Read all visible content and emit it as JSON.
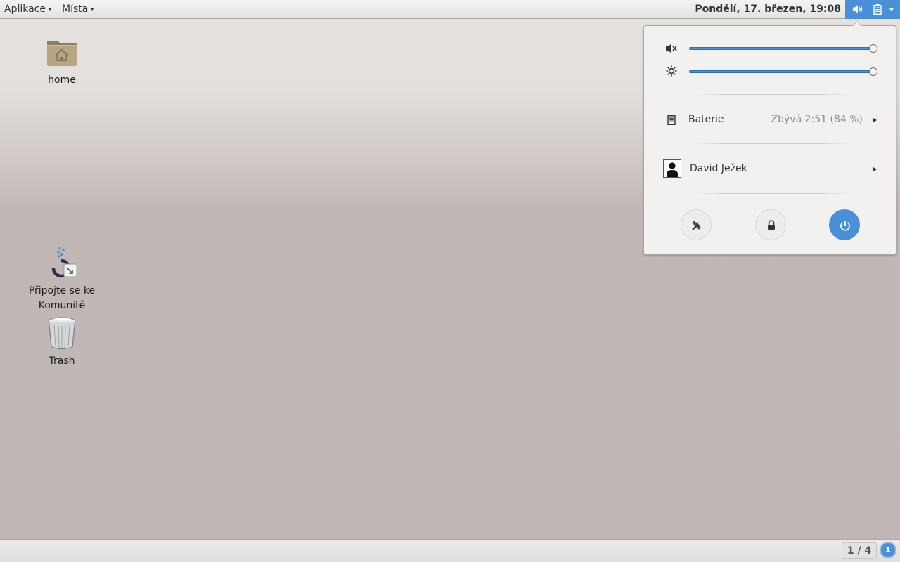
{
  "topbar": {
    "applications_label": "Aplikace",
    "places_label": "Místa",
    "clock": "Pondělí, 17. březen, 19:08",
    "icons": [
      "speaker-icon",
      "battery-icon",
      "chevron-down-icon"
    ]
  },
  "desktop": {
    "icons": [
      {
        "label": "home",
        "icon": "home-folder-icon"
      },
      {
        "label": "Připojte se ke Komunitě",
        "icon": "community-link-icon"
      },
      {
        "label": "Trash",
        "icon": "trash-icon"
      }
    ]
  },
  "popover": {
    "volume": {
      "icon": "speaker-muted-icon",
      "level": 1.0
    },
    "brightness": {
      "icon": "brightness-icon",
      "level": 1.0
    },
    "battery": {
      "label": "Baterie",
      "value": "Zbývá 2:51 (84 %)",
      "icon": "battery-icon"
    },
    "user": {
      "name": "David Ježek",
      "icon": "avatar-icon"
    },
    "buttons": [
      "settings-icon",
      "lock-icon",
      "power-icon"
    ]
  },
  "bottombar": {
    "workspace": "1 / 4",
    "notification_count": "1"
  },
  "colors": {
    "accent": "#4a90d9",
    "panel_bg": "#f2f1f0"
  }
}
